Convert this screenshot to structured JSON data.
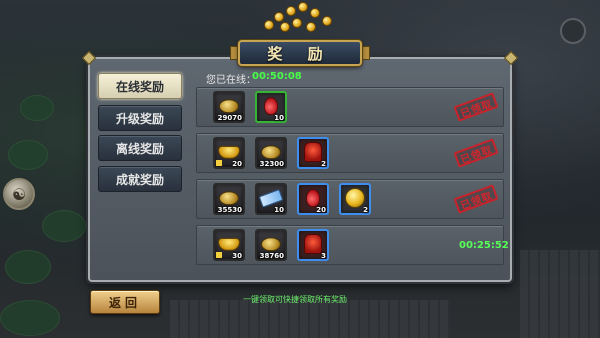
{
  "title": "奖 励",
  "tabs": [
    {
      "label": "在线奖励",
      "active": true
    },
    {
      "label": "升级奖励",
      "active": false
    },
    {
      "label": "离线奖励",
      "active": false
    },
    {
      "label": "成就奖励",
      "active": false
    }
  ],
  "online": {
    "label": "您已在线：",
    "time": "00:50:08"
  },
  "rows": [
    {
      "items": [
        {
          "icon": "copper-coin-icon",
          "qty": "29070"
        },
        {
          "icon": "red-potion-icon",
          "qty": "10",
          "border": "green"
        }
      ],
      "status": "已领取"
    },
    {
      "items": [
        {
          "icon": "gold-ingot-icon",
          "qty": "20"
        },
        {
          "icon": "copper-coin-icon",
          "qty": "32300"
        },
        {
          "icon": "red-armor-icon",
          "qty": "2",
          "border": "blue"
        }
      ],
      "status": "已领取"
    },
    {
      "items": [
        {
          "icon": "copper-coin-icon",
          "qty": "35530"
        },
        {
          "icon": "blue-scroll-icon",
          "qty": "10"
        },
        {
          "icon": "red-potion-icon",
          "qty": "20",
          "border": "blue"
        },
        {
          "icon": "gold-orb-icon",
          "qty": "2",
          "border": "blue"
        }
      ],
      "status": "已领取"
    },
    {
      "items": [
        {
          "icon": "gold-ingot-icon",
          "qty": "30"
        },
        {
          "icon": "copper-coin-icon",
          "qty": "38760"
        },
        {
          "icon": "red-armor-icon",
          "qty": "3",
          "border": "blue"
        }
      ],
      "countdown": "00:25:52"
    }
  ],
  "back_label": "返回",
  "hint": "一键领取可快捷领取所有奖励",
  "colors": {
    "accent_green": "#47ff47",
    "stamp_red": "#d1262d",
    "gold": "#c7a552"
  }
}
